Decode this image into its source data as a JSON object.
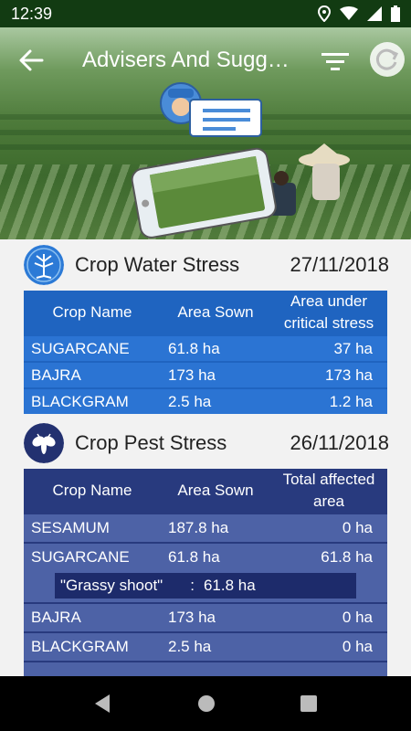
{
  "status": {
    "time": "12:39"
  },
  "header": {
    "title": "Advisers And Suggestions"
  },
  "icons": {
    "back": "arrow-left-icon",
    "filter": "filter-icon",
    "refresh": "refresh-icon",
    "location": "location-icon",
    "wifi": "wifi-icon",
    "battery": "battery-icon",
    "cell": "cell-signal-icon"
  },
  "colors": {
    "water_header": "#1f64c0",
    "water_row": "#2b74d3",
    "pest_header": "#283a7e",
    "pest_row": "#4d62a6"
  },
  "water_stress": {
    "title": "Crop Water Stress",
    "date": "27/11/2018",
    "columns": [
      "Crop Name",
      "Area Sown",
      "Area under critical stress"
    ],
    "rows": [
      [
        "SUGARCANE",
        "61.8 ha",
        "37 ha"
      ],
      [
        "BAJRA",
        "173 ha",
        "173 ha"
      ],
      [
        "BLACKGRAM",
        "2.5 ha",
        "1.2 ha"
      ]
    ]
  },
  "pest_stress": {
    "title": "Crop Pest Stress",
    "date": "26/11/2018",
    "columns": [
      "Crop Name",
      "Area Sown",
      "Total affected area"
    ],
    "rows": [
      [
        "SESAMUM",
        "187.8 ha",
        "0 ha"
      ],
      [
        "SUGARCANE",
        "61.8 ha",
        "61.8 ha"
      ],
      [
        "BAJRA",
        "173 ha",
        "0 ha"
      ],
      [
        "BLACKGRAM",
        "2.5 ha",
        "0 ha"
      ]
    ],
    "detail": {
      "pest": "\"Grassy shoot\"",
      "separator": ":",
      "area": "61.8 ha"
    }
  }
}
